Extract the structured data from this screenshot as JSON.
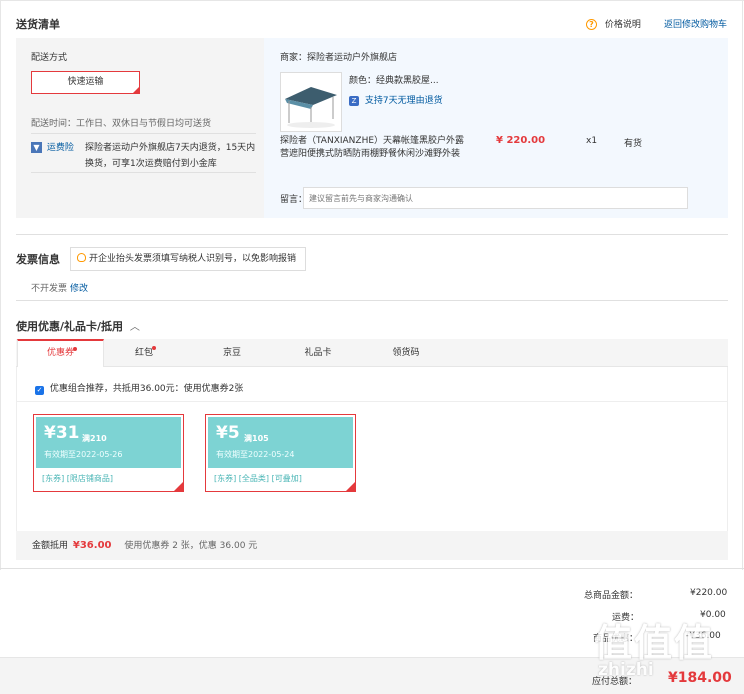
{
  "section_title": "送货清单",
  "price_help": {
    "label": "价格说明"
  },
  "back_to_cart": "返回修改购物车",
  "delivery": {
    "title": "配送方式",
    "method": "快速运输",
    "time": "配送时间：工作日、双休日与节假日均可送货",
    "insurance_label": "运费险",
    "insurance_desc_1": "探险者运动户外旗舰店7天内退货，15天内",
    "insurance_desc_2": "换货，可享1次运费赔付到小金库"
  },
  "shop": {
    "merchant": "商家：探险者运动户外旗舰店",
    "color": "颜色：经典款黑胶屋...",
    "return_policy": "支持7天无理由退货",
    "product_name_1": "探险者（TANXIANZHE）天幕帐篷黑胶户外露",
    "product_name_2": "营遮阳便携式防晒防雨棚野餐休闲沙滩野外装",
    "price": "¥ 220.00",
    "qty": "x1",
    "stock": "有货",
    "memo_label": "留言：",
    "memo_placeholder": "建议留言前先与商家沟通确认"
  },
  "invoice": {
    "title": "发票信息",
    "tip": "开企业抬头发票须填写纳税人识别号，以免影响报销",
    "status": "不开发票",
    "edit": "修改"
  },
  "discount": {
    "title": "使用优惠/礼品卡/抵用",
    "tabs": [
      "优惠券",
      "红包",
      "京豆",
      "礼品卡",
      "领货码"
    ],
    "recommend": "优惠组合推荐，共抵用36.00元：使用优惠券2张",
    "coupons": [
      {
        "amount": "¥31",
        "condition": "满210",
        "expiry": "有效期至2022-05-26",
        "tags": "[东券]  [限店铺商品]"
      },
      {
        "amount": "¥5",
        "condition": "满105",
        "expiry": "有效期至2022-05-24",
        "tags": "[东券]  [全品类]  [可叠加]"
      }
    ],
    "summary_label": "金额抵用",
    "summary_amount": "¥36.00",
    "summary_desc": "使用优惠券 2 张，优惠 36.00 元"
  },
  "totals": {
    "goods_label": "总商品金额：",
    "goods_value": "¥220.00",
    "freight_label": "运费：",
    "freight_value": "¥0.00",
    "coupon_label": "商品优惠：",
    "coupon_value": "-¥36.00",
    "payable_label": "应付总额：",
    "payable_value": "¥184.00"
  },
  "watermark": {
    "logo": "值",
    "text": "zhizhi"
  },
  "colors": {
    "accent": "#e4393c",
    "link": "#005aa0",
    "coupon": "#7dd3d3"
  }
}
